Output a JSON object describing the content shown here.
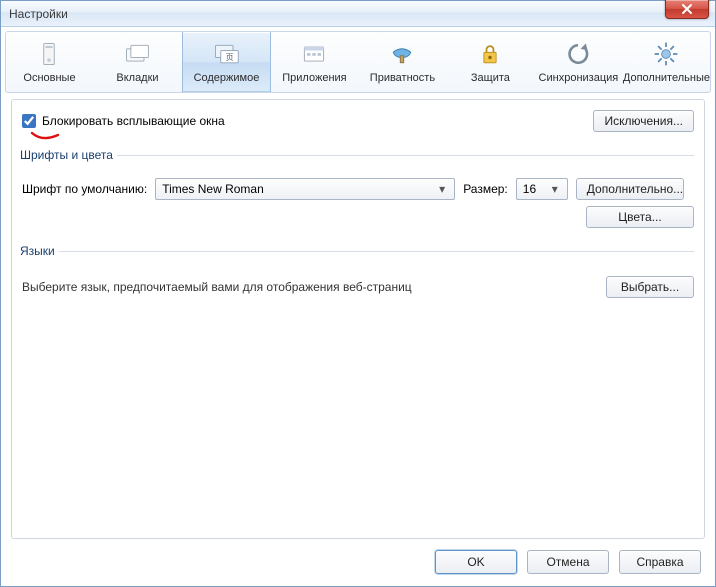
{
  "window": {
    "title": "Настройки"
  },
  "tabs": [
    {
      "id": "general",
      "label": "Основные"
    },
    {
      "id": "tabs",
      "label": "Вкладки"
    },
    {
      "id": "content",
      "label": "Содержимое",
      "selected": true
    },
    {
      "id": "apps",
      "label": "Приложения"
    },
    {
      "id": "privacy",
      "label": "Приватность"
    },
    {
      "id": "security",
      "label": "Защита"
    },
    {
      "id": "sync",
      "label": "Синхронизация"
    },
    {
      "id": "advanced",
      "label": "Дополнительные"
    }
  ],
  "content": {
    "block_popups_label": "Блокировать всплывающие окна",
    "block_popups_checked": true,
    "exceptions_button": "Исключения...",
    "fonts_section_title": "Шрифты и цвета",
    "default_font_label": "Шрифт по умолчанию:",
    "default_font_value": "Times New Roman",
    "size_label": "Размер:",
    "size_value": "16",
    "advanced_button": "Дополнительно...",
    "colors_button": "Цвета...",
    "languages_section_title": "Языки",
    "languages_desc": "Выберите язык, предпочитаемый вами для отображения веб-страниц",
    "choose_button": "Выбрать..."
  },
  "buttons": {
    "ok": "OK",
    "cancel": "Отмена",
    "help": "Справка"
  }
}
